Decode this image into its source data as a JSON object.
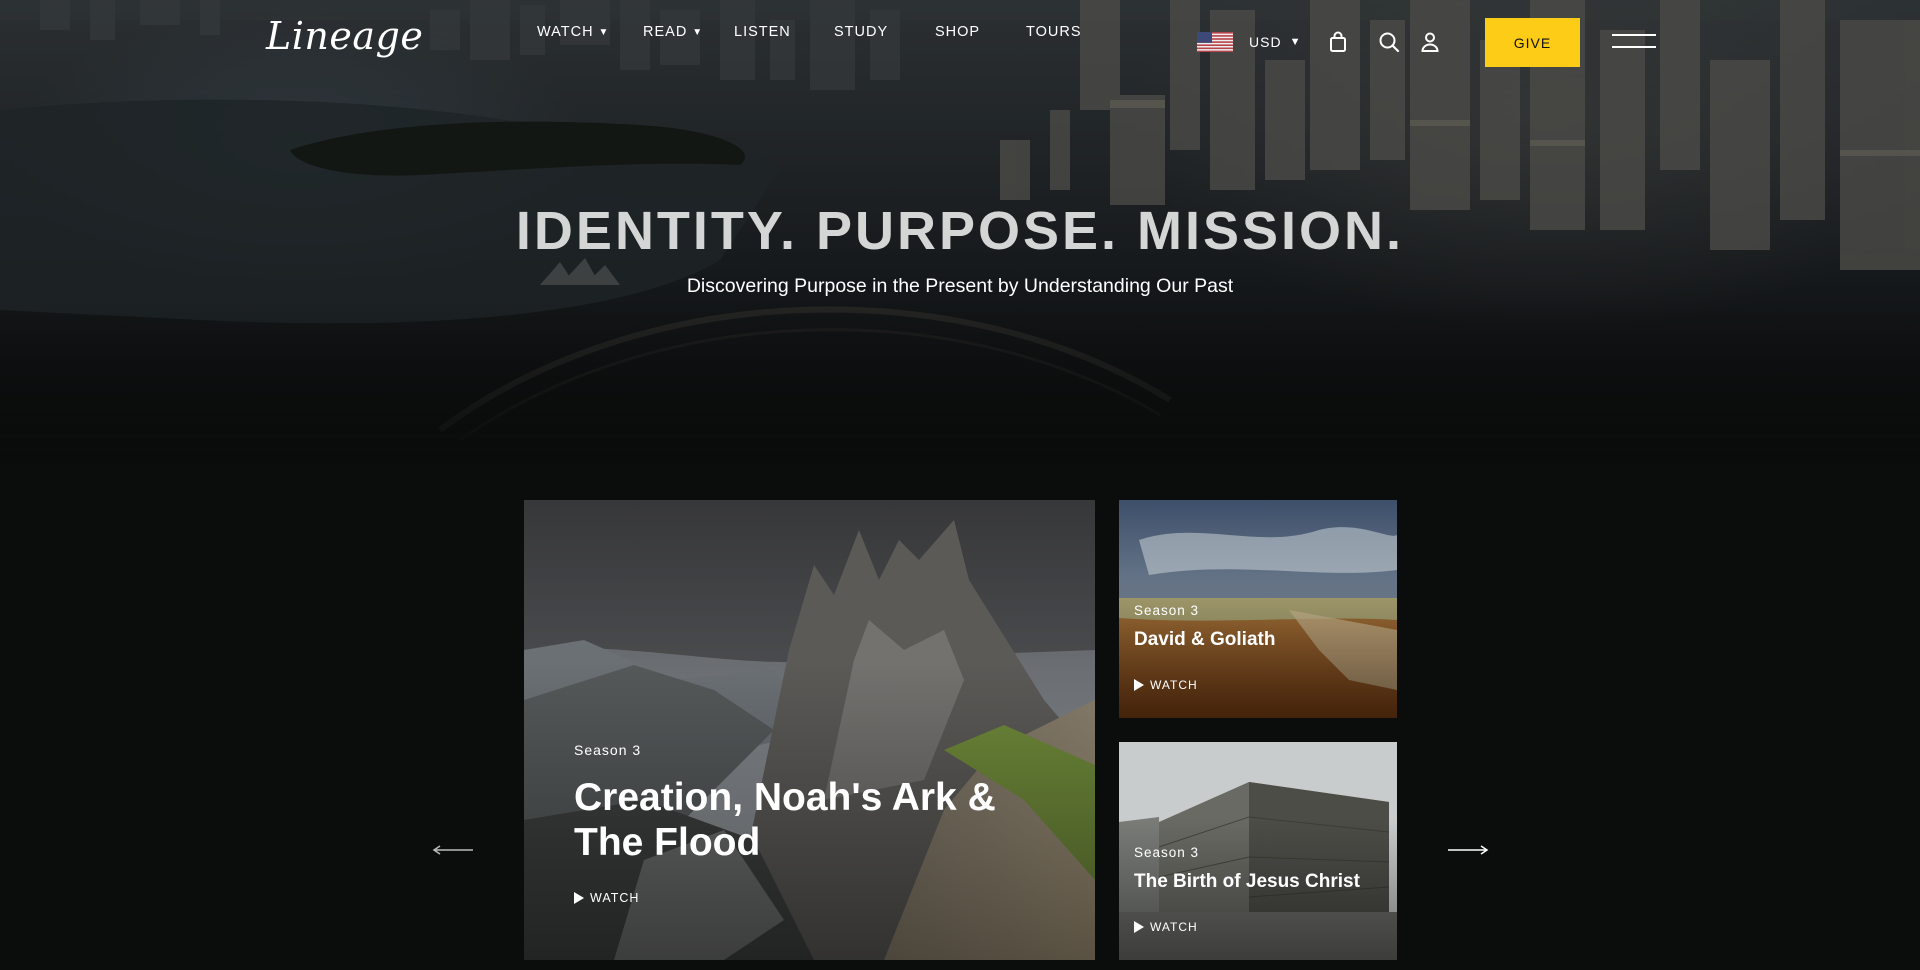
{
  "brand": {
    "logo_text": "Lineage"
  },
  "nav": {
    "items": [
      {
        "label": "WATCH",
        "has_dropdown": true
      },
      {
        "label": "READ",
        "has_dropdown": true
      },
      {
        "label": "LISTEN",
        "has_dropdown": false
      },
      {
        "label": "STUDY",
        "has_dropdown": false
      },
      {
        "label": "SHOP",
        "has_dropdown": false
      },
      {
        "label": "TOURS",
        "has_dropdown": false
      }
    ]
  },
  "utilities": {
    "currency": "USD",
    "flag_icon": "us-flag-icon",
    "cart_icon": "shopping-bag-icon",
    "search_icon": "search-icon",
    "account_icon": "user-icon",
    "menu_icon": "hamburger-menu-icon"
  },
  "give_button": {
    "label": "GIVE",
    "color": "#fdcc16"
  },
  "hero": {
    "title": "IDENTITY. PURPOSE. MISSION.",
    "subtitle": "Discovering Purpose in the Present by Understanding Our Past"
  },
  "carousel": {
    "prev_icon": "arrow-left-icon",
    "next_icon": "arrow-right-icon",
    "cards": [
      {
        "season": "Season 3",
        "title": "Creation, Noah's Ark & The Flood",
        "action": "WATCH"
      },
      {
        "season": "Season 3",
        "title": "David & Goliath",
        "action": "WATCH"
      },
      {
        "season": "Season 3",
        "title": "The Birth of Jesus Christ",
        "action": "WATCH"
      }
    ]
  }
}
